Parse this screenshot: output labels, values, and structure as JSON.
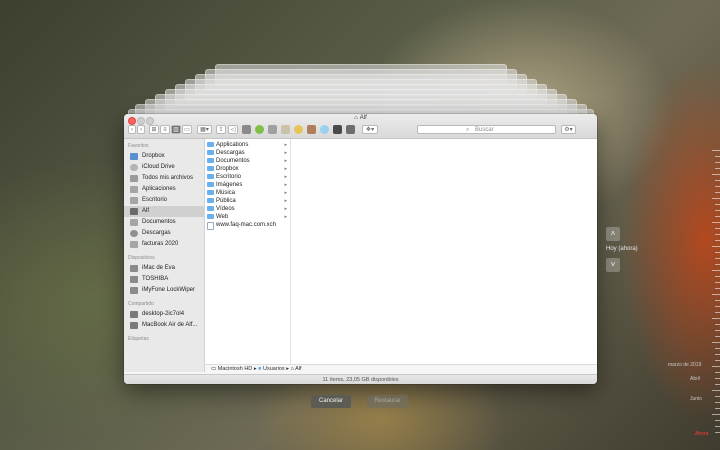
{
  "window": {
    "title": "Alf",
    "search_placeholder": "Buscar",
    "status": "11 ítems, 23,05 GB disponibles",
    "path": [
      "Macintosh HD",
      "Usuarios",
      "Alf"
    ]
  },
  "sidebar": {
    "sections": [
      {
        "heading": "Favoritos",
        "items": [
          "Dropbox",
          "iCloud Drive",
          "Todos mis archivos",
          "Aplicaciones",
          "Escritorio",
          "Alf",
          "Documentos",
          "Descargas",
          "facturas 2020"
        ]
      },
      {
        "heading": "Dispositivos",
        "items": [
          "iMac de Eva",
          "TOSHIBA",
          "iMyFone LockWiper"
        ]
      },
      {
        "heading": "Compartido",
        "items": [
          "desktop-2ic7ol4",
          "MacBook Air de Alf..."
        ]
      },
      {
        "heading": "Etiquetas",
        "items": []
      }
    ],
    "selected": "Alf"
  },
  "files": [
    {
      "name": "Applications",
      "type": "folder"
    },
    {
      "name": "Descargas",
      "type": "folder"
    },
    {
      "name": "Documentos",
      "type": "folder"
    },
    {
      "name": "Dropbox",
      "type": "folder"
    },
    {
      "name": "Escritorio",
      "type": "folder"
    },
    {
      "name": "Imágenes",
      "type": "folder"
    },
    {
      "name": "Música",
      "type": "folder"
    },
    {
      "name": "Pública",
      "type": "folder"
    },
    {
      "name": "Vídeos",
      "type": "folder"
    },
    {
      "name": "Web",
      "type": "folder"
    },
    {
      "name": "www.faq-mac.com.xch",
      "type": "file"
    }
  ],
  "buttons": {
    "cancel": "Cancelar",
    "restore": "Restaurar"
  },
  "time_machine": {
    "current": "Hoy (ahora)",
    "timeline": [
      "marzo de 2019",
      "Abril",
      "Junio",
      "Ahora"
    ]
  },
  "colors": {
    "accent_now": "#ff3b30",
    "folder": "#6ab0f0",
    "close": "#fc605c"
  }
}
